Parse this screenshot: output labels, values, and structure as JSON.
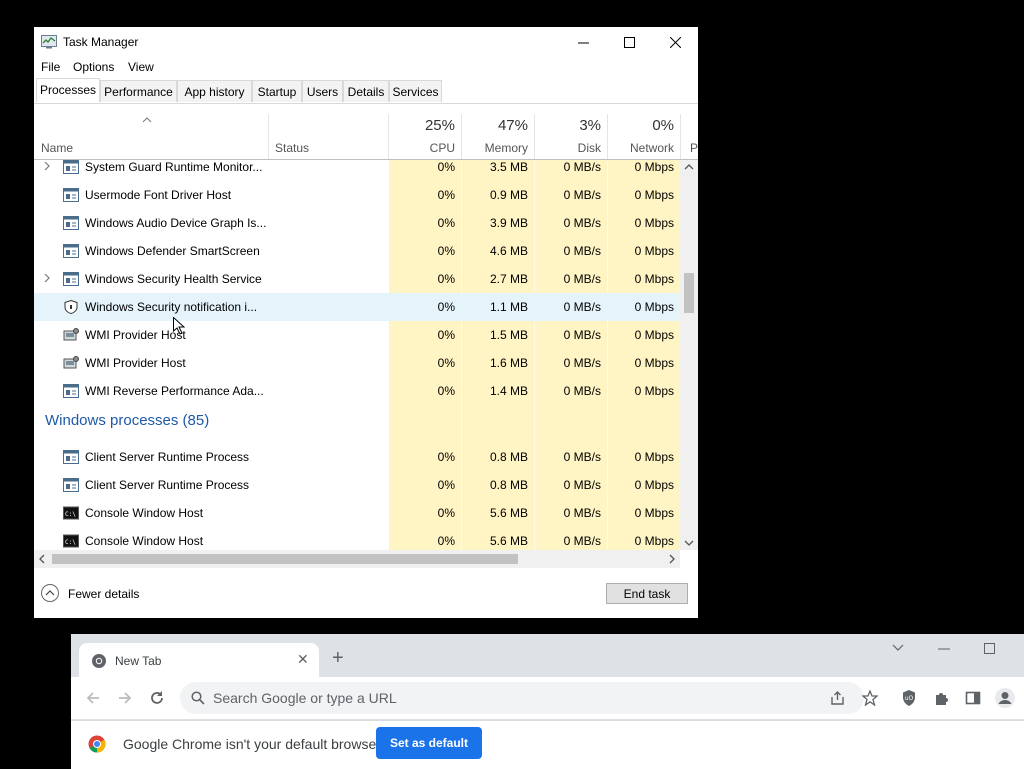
{
  "task_manager": {
    "title": "Task Manager",
    "menu": [
      "File",
      "Options",
      "View"
    ],
    "tabs": [
      "Processes",
      "Performance",
      "App history",
      "Startup",
      "Users",
      "Details",
      "Services"
    ],
    "columns": {
      "name": "Name",
      "status": "Status",
      "cpu": {
        "pct": "25%",
        "label": "CPU"
      },
      "memory": {
        "pct": "47%",
        "label": "Memory"
      },
      "disk": {
        "pct": "3%",
        "label": "Disk"
      },
      "network": {
        "pct": "0%",
        "label": "Network"
      },
      "power_cut": "P"
    },
    "rows": [
      {
        "name": "System Guard Runtime Monitor...",
        "cpu": "0%",
        "memory": "3.5 MB",
        "disk": "0 MB/s",
        "network": "0 Mbps",
        "expandable": true,
        "icon": "service-icon"
      },
      {
        "name": "Usermode Font Driver Host",
        "cpu": "0%",
        "memory": "0.9 MB",
        "disk": "0 MB/s",
        "network": "0 Mbps",
        "expandable": false,
        "icon": "service-icon"
      },
      {
        "name": "Windows Audio Device Graph Is...",
        "cpu": "0%",
        "memory": "3.9 MB",
        "disk": "0 MB/s",
        "network": "0 Mbps",
        "expandable": false,
        "icon": "service-icon"
      },
      {
        "name": "Windows Defender SmartScreen",
        "cpu": "0%",
        "memory": "4.6 MB",
        "disk": "0 MB/s",
        "network": "0 Mbps",
        "expandable": false,
        "icon": "service-icon"
      },
      {
        "name": "Windows Security Health Service",
        "cpu": "0%",
        "memory": "2.7 MB",
        "disk": "0 MB/s",
        "network": "0 Mbps",
        "expandable": true,
        "icon": "service-icon"
      },
      {
        "name": "Windows Security notification i...",
        "cpu": "0%",
        "memory": "1.1 MB",
        "disk": "0 MB/s",
        "network": "0 Mbps",
        "expandable": false,
        "icon": "shield-icon"
      },
      {
        "name": "WMI Provider Host",
        "cpu": "0%",
        "memory": "1.5 MB",
        "disk": "0 MB/s",
        "network": "0 Mbps",
        "expandable": false,
        "icon": "wmi-icon"
      },
      {
        "name": "WMI Provider Host",
        "cpu": "0%",
        "memory": "1.6 MB",
        "disk": "0 MB/s",
        "network": "0 Mbps",
        "expandable": false,
        "icon": "wmi-icon"
      },
      {
        "name": "WMI Reverse Performance Ada...",
        "cpu": "0%",
        "memory": "1.4 MB",
        "disk": "0 MB/s",
        "network": "0 Mbps",
        "expandable": false,
        "icon": "service-icon"
      }
    ],
    "group_title": "Windows processes (85)",
    "group_rows": [
      {
        "name": "Client Server Runtime Process",
        "cpu": "0%",
        "memory": "0.8 MB",
        "disk": "0 MB/s",
        "network": "0 Mbps",
        "icon": "service-icon"
      },
      {
        "name": "Client Server Runtime Process",
        "cpu": "0%",
        "memory": "0.8 MB",
        "disk": "0 MB/s",
        "network": "0 Mbps",
        "icon": "service-icon"
      },
      {
        "name": "Console Window Host",
        "cpu": "0%",
        "memory": "5.6 MB",
        "disk": "0 MB/s",
        "network": "0 Mbps",
        "icon": "console-icon"
      },
      {
        "name": "Console Window Host",
        "cpu": "0%",
        "memory": "5.6 MB",
        "disk": "0 MB/s",
        "network": "0 Mbps",
        "icon": "console-icon"
      }
    ],
    "fewer_details": "Fewer details",
    "end_task": "End task"
  },
  "chrome": {
    "tab_title": "New Tab",
    "omnibox_placeholder": "Search Google or type a URL",
    "infobar_text": "Google Chrome isn't your default browser",
    "set_default_label": "Set as default",
    "accent": "#1a73e8"
  }
}
